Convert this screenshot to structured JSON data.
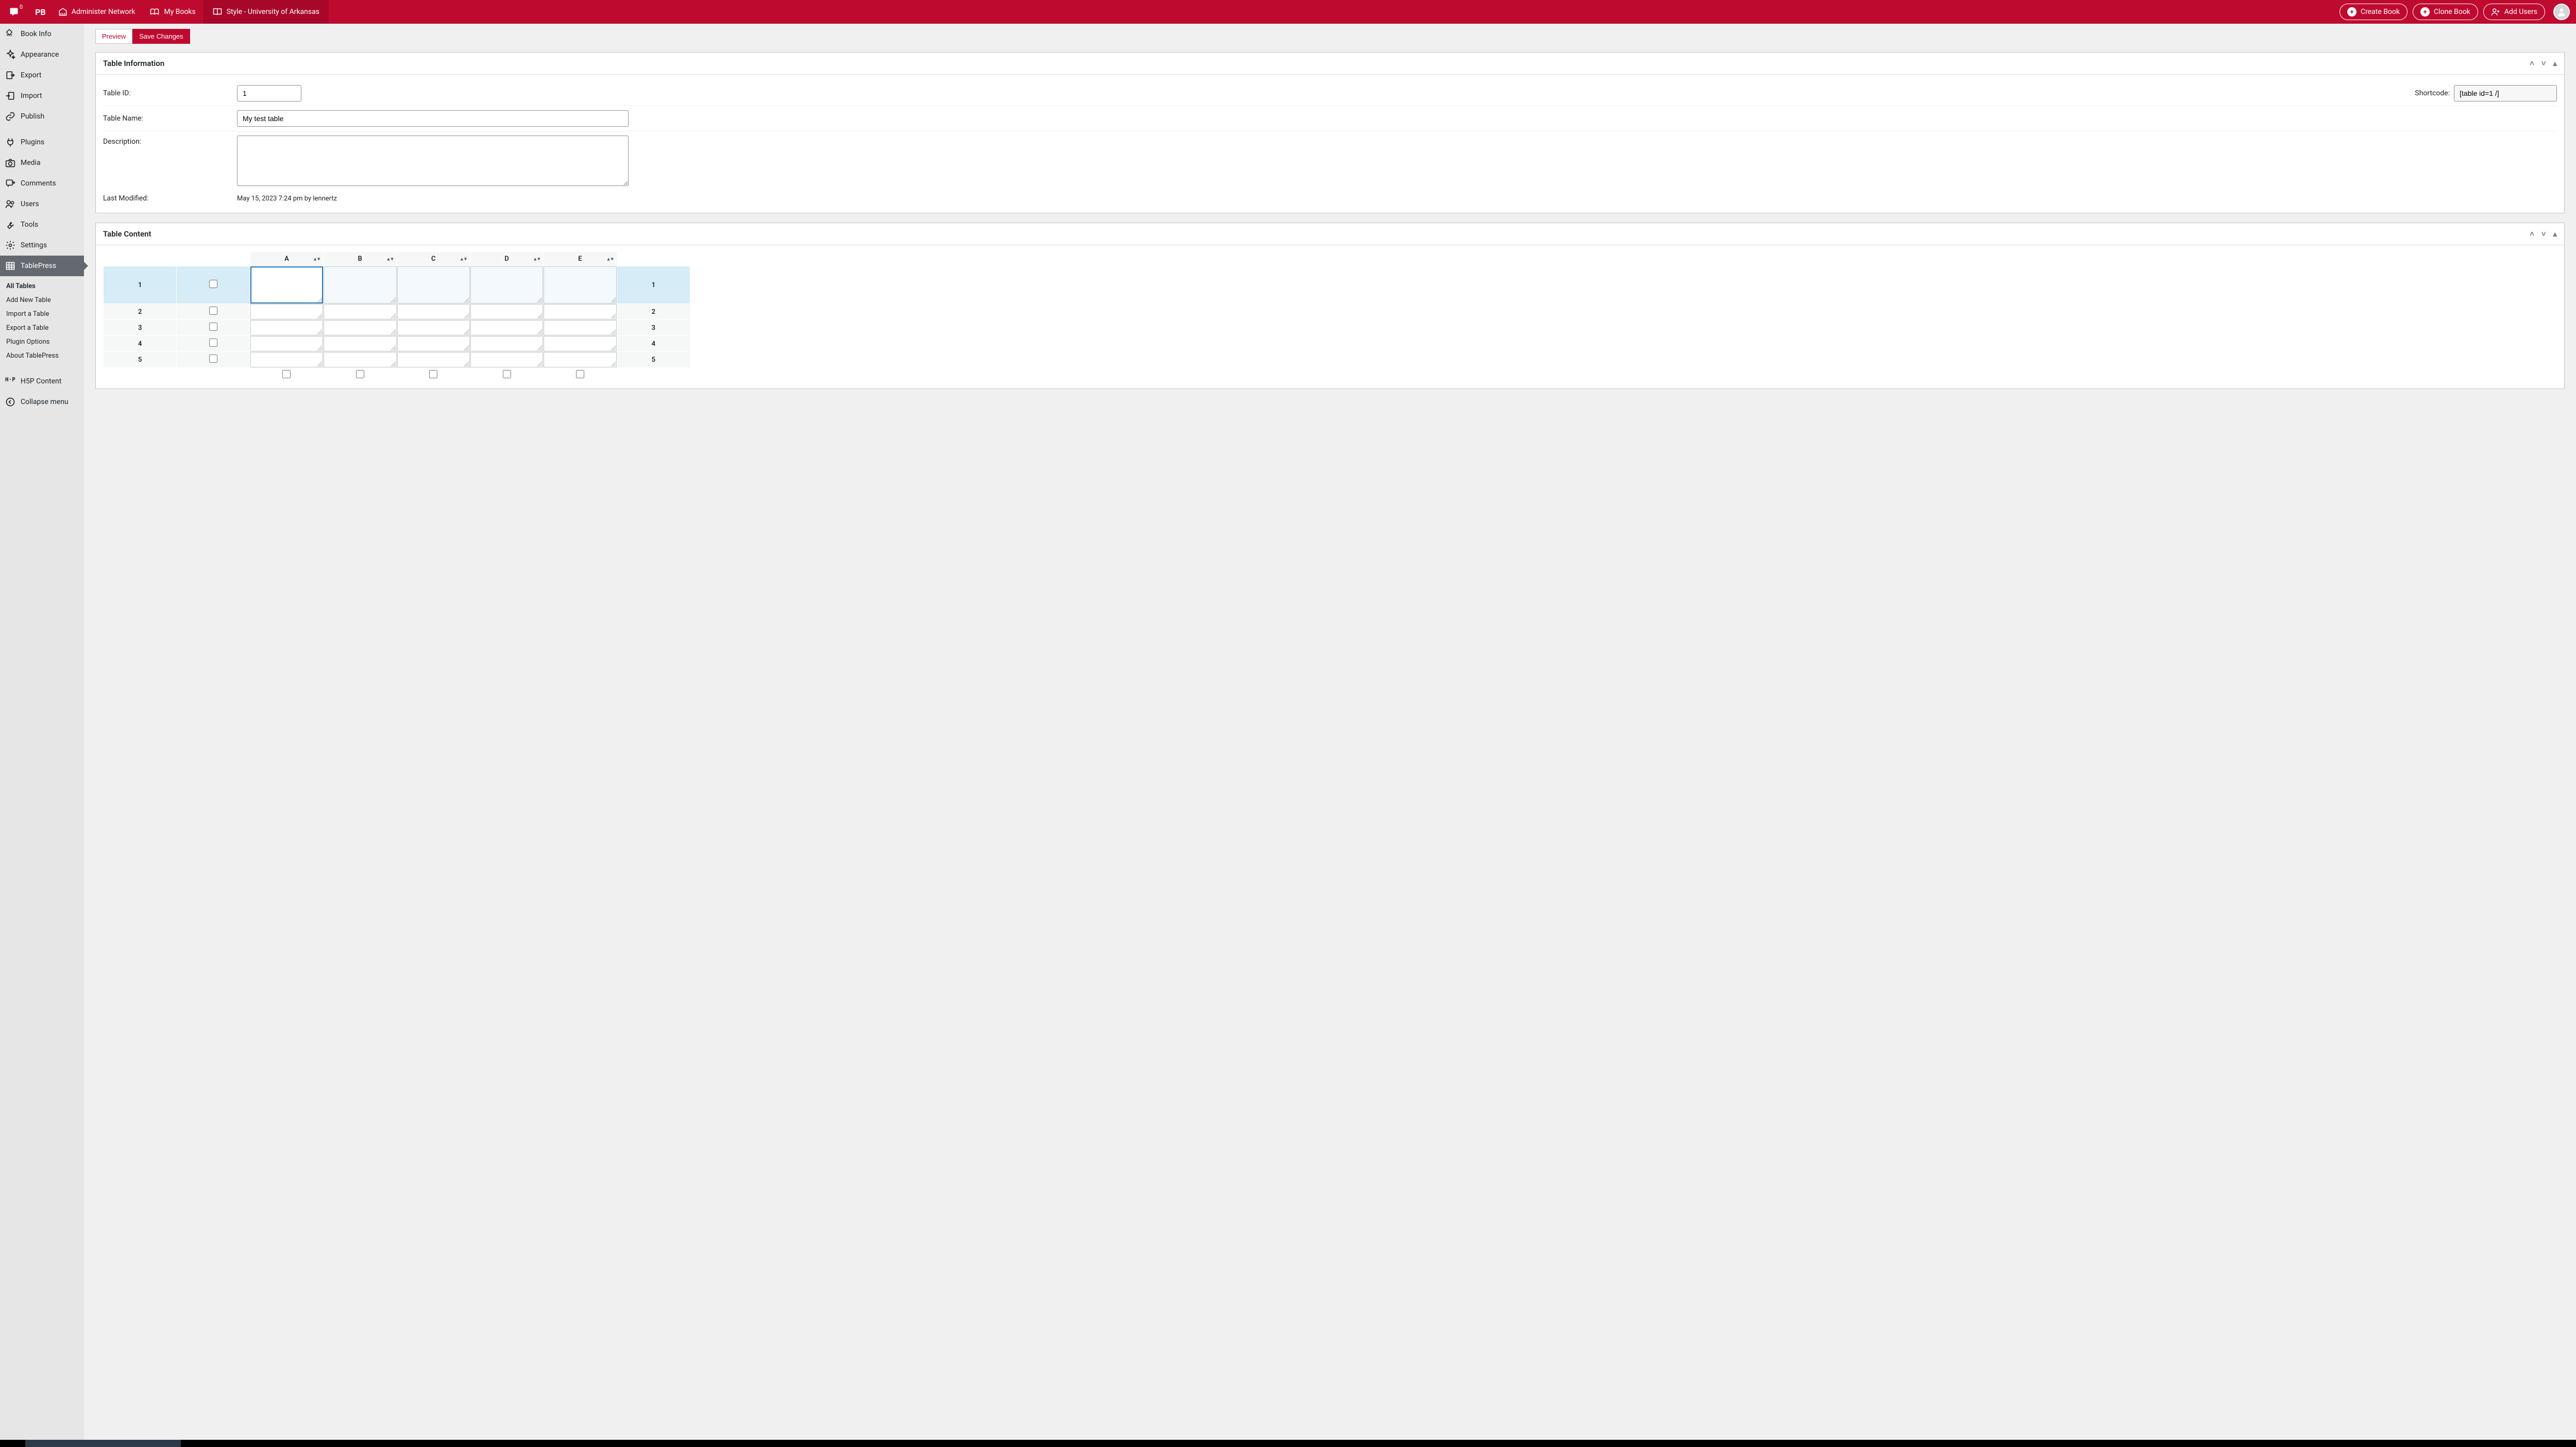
{
  "adminbar": {
    "comment_count": "0",
    "pb_logo": "PB",
    "administer_label": "Administer Network",
    "my_books_label": "My Books",
    "current_site_label": "Style - University of Arkansas",
    "create_book_label": "Create Book",
    "clone_book_label": "Clone Book",
    "add_users_label": "Add Users"
  },
  "sidebar": {
    "book_info": "Book Info",
    "appearance": "Appearance",
    "export": "Export",
    "import": "Import",
    "publish": "Publish",
    "plugins": "Plugins",
    "media": "Media",
    "comments": "Comments",
    "users": "Users",
    "tools": "Tools",
    "settings": "Settings",
    "tablepress": "TablePress",
    "submenu": {
      "all_tables": "All Tables",
      "add_new": "Add New Table",
      "import": "Import a Table",
      "export": "Export a Table",
      "plugin_options": "Plugin Options",
      "about": "About TablePress"
    },
    "h5p": "H5P Content",
    "h5p_logo": "H·P",
    "collapse": "Collapse menu"
  },
  "actions": {
    "preview": "Preview",
    "save": "Save Changes"
  },
  "table_info": {
    "heading": "Table Information",
    "id_label": "Table ID:",
    "id_value": "1",
    "shortcode_label": "Shortcode:",
    "shortcode_value": "[table id=1 /]",
    "name_label": "Table Name:",
    "name_value": "My test table",
    "desc_label": "Description:",
    "desc_value": "",
    "last_mod_label": "Last Modified:",
    "last_mod_value": "May 15, 2023 7:24 pm by lennertz"
  },
  "table_content": {
    "heading": "Table Content",
    "columns": [
      "A",
      "B",
      "C",
      "D",
      "E"
    ],
    "rows": [
      "1",
      "2",
      "3",
      "4",
      "5"
    ]
  }
}
